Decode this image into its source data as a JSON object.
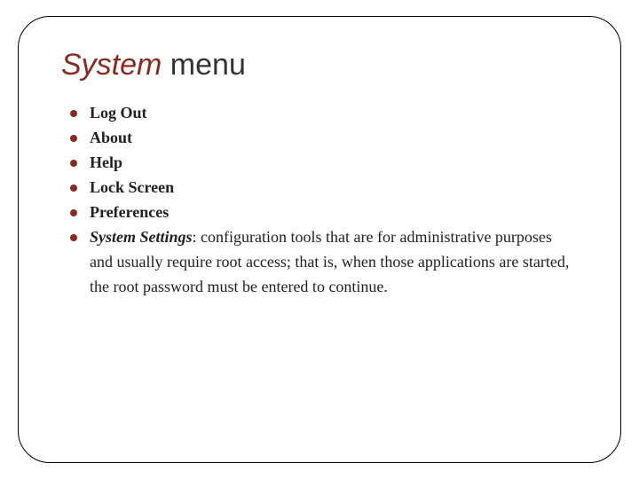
{
  "title": {
    "emph": "System",
    "rest": " menu"
  },
  "items": [
    {
      "kind": "simple",
      "text": "Log Out"
    },
    {
      "kind": "simple",
      "text": "About"
    },
    {
      "kind": "simple",
      "text": "Help"
    },
    {
      "kind": "simple",
      "text": "Lock Screen"
    },
    {
      "kind": "simple",
      "text": "Preferences"
    },
    {
      "kind": "rich",
      "label": "System Settings",
      "desc": "configuration tools that are for administrative purposes and usually require root access; that is, when those applications are started, the root password must be entered to continue."
    }
  ]
}
